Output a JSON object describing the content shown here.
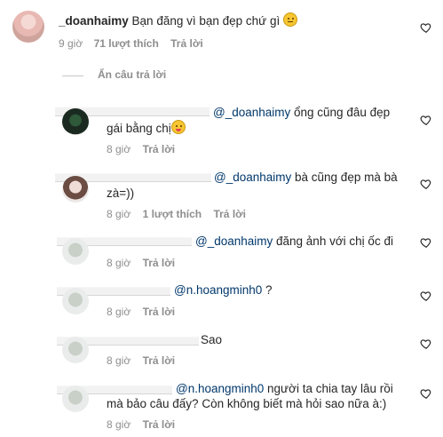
{
  "main_comment": {
    "username": "_doanhaimy",
    "text": "Bạn đăng vì bạn đẹp chứ gì",
    "time": "9 giờ",
    "likes": "71 lượt thích",
    "reply": "Trả lời",
    "emoji": "slight-smile-emoji"
  },
  "hide_replies": "Ẩn câu trả lời",
  "replies": [
    {
      "mention": "@_doanhaimy",
      "line1": " ổng cũng đâu đẹp",
      "line2": "gái bằng chị",
      "time": "8 giờ",
      "likes": "",
      "reply": "Trả lời"
    },
    {
      "mention": "@_doanhaimy",
      "line1": " bà cũng đẹp mà bà",
      "line2": "zà=))",
      "time": "8 giờ",
      "likes": "1 lượt thích",
      "reply": "Trả lời"
    },
    {
      "mention": "@_doanhaimy",
      "line1": " đăng ảnh với chị ốc đi",
      "line2": "",
      "time": "8 giờ",
      "likes": "",
      "reply": "Trả lời"
    },
    {
      "mention": "@n.hoangminh0",
      "line1": " ?",
      "line2": "",
      "time": "8 giờ",
      "likes": "",
      "reply": "Trả lời"
    },
    {
      "mention": "",
      "line1": "Sao",
      "line2": "",
      "time": "8 giờ",
      "likes": "",
      "reply": "Trả lời"
    },
    {
      "mention": "@n.hoangminh0",
      "line1": " người ta chia tay lâu rồi",
      "line2": "mà bảo câu đấy? Còn không biết mà hỏi sao nữa à:)",
      "time": "8 giờ",
      "likes": "",
      "reply": "Trả lời"
    }
  ],
  "icons": {
    "like": "heart-outline-icon"
  }
}
